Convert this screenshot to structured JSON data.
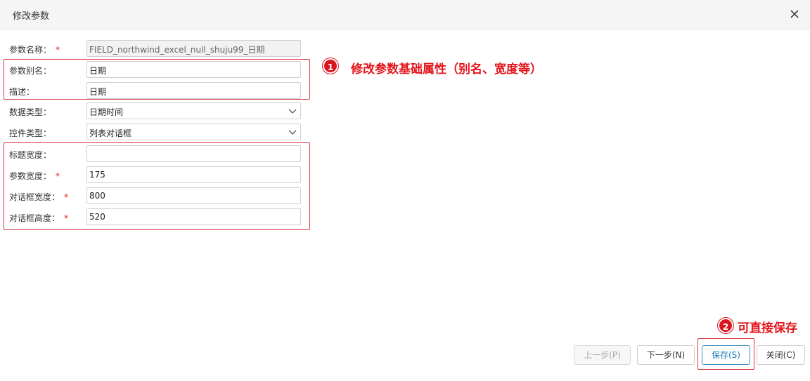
{
  "dialog": {
    "title": "修改参数"
  },
  "form": {
    "name": {
      "label": "参数名称：",
      "required": "*",
      "value": "FIELD_northwind_excel_null_shuju99_日期"
    },
    "alias": {
      "label": "参数别名：",
      "value": "日期"
    },
    "desc": {
      "label": "描述：",
      "value": "日期"
    },
    "datatype": {
      "label": "数据类型：",
      "value": "日期时间"
    },
    "ctrltype": {
      "label": "控件类型：",
      "value": "列表对话框"
    },
    "titlewidth": {
      "label": "标题宽度：",
      "value": ""
    },
    "paramwidth": {
      "label": "参数宽度：",
      "required": "*",
      "value": "175"
    },
    "dlgwidth": {
      "label": "对话框宽度：",
      "required": "*",
      "value": "800"
    },
    "dlgheight": {
      "label": "对话框高度：",
      "required": "*",
      "value": "520"
    }
  },
  "annotations": {
    "one": {
      "num": "1",
      "text": "修改参数基础属性（别名、宽度等）"
    },
    "two": {
      "num": "2",
      "text": "可直接保存"
    }
  },
  "buttons": {
    "prev": "上一步(P)",
    "next": "下一步(N)",
    "save": "保存(S)",
    "close": "关闭(C)"
  },
  "icons": {
    "close": "close-icon",
    "dropdown": "chevron-down-icon"
  },
  "colors": {
    "annotation_red": "#e4141b",
    "primary_blue": "#1e7ab5",
    "required_red": "#e02020"
  }
}
